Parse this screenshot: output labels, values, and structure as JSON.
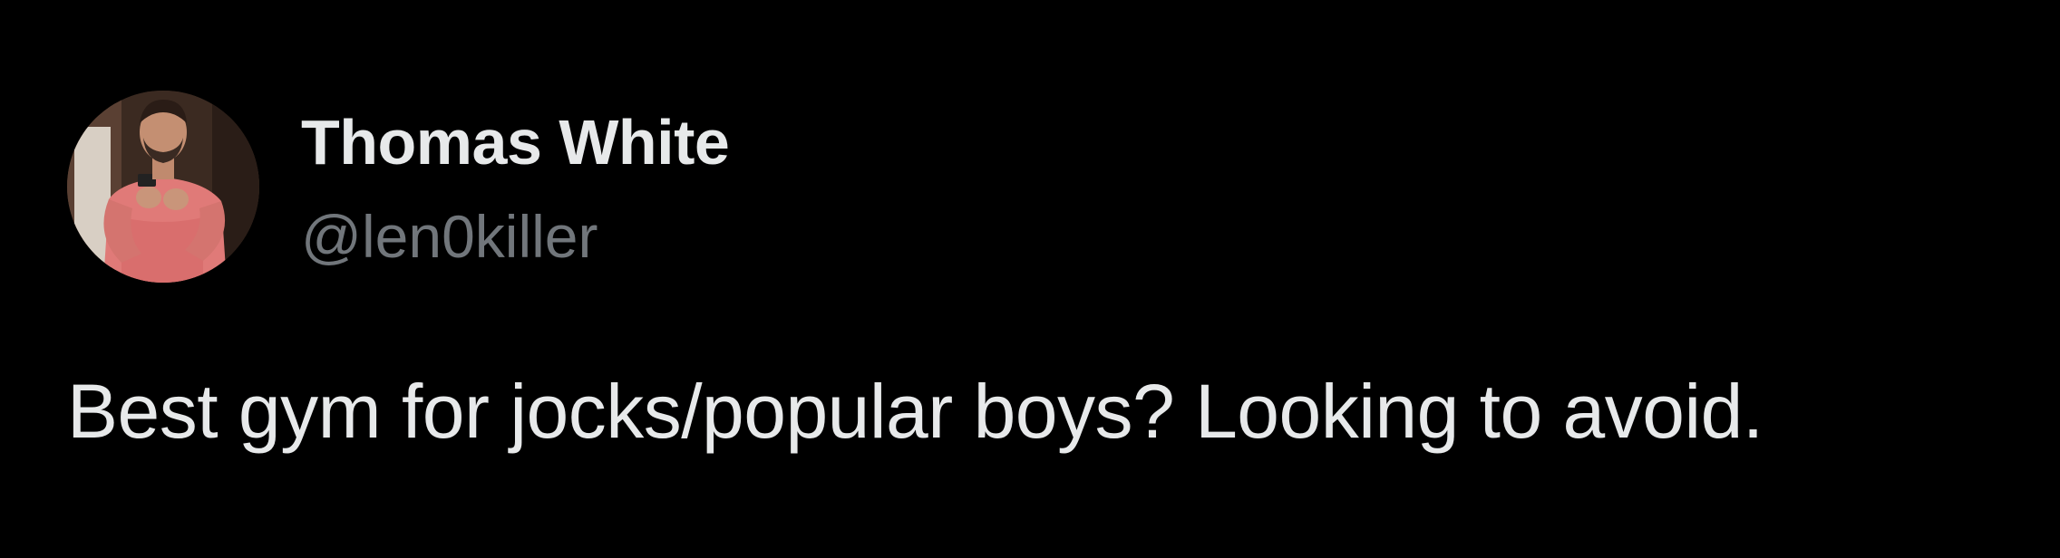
{
  "tweet": {
    "author": {
      "display_name": "Thomas White",
      "handle": "@len0killer",
      "avatar": "profile-photo"
    },
    "text": "Best gym for jocks/popular boys? Looking to avoid."
  },
  "colors": {
    "background": "#000000",
    "primary_text": "#e7e9ea",
    "secondary_text": "#71767b"
  }
}
